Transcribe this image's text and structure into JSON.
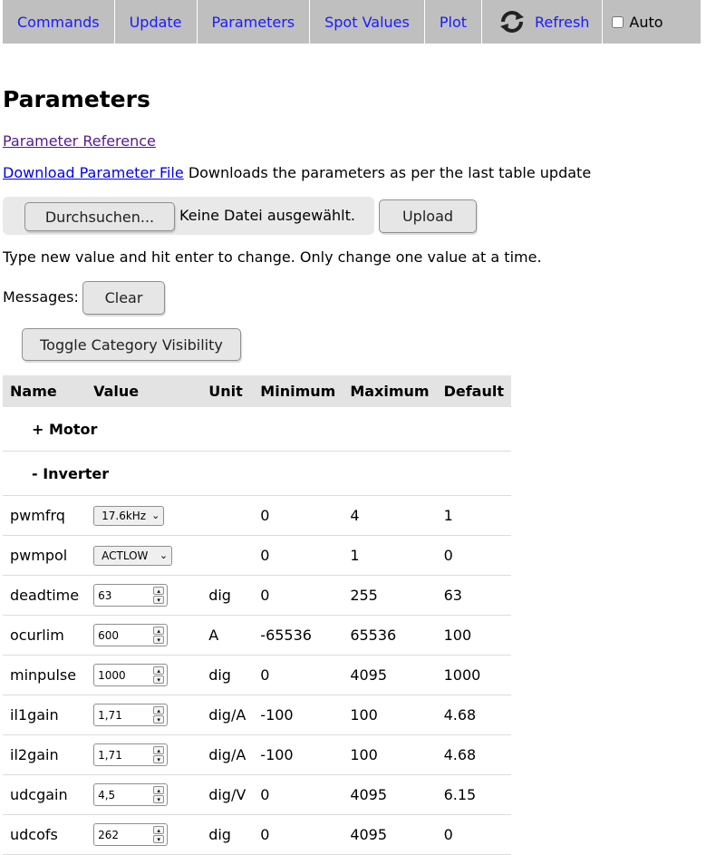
{
  "nav": {
    "items": [
      "Commands",
      "Update",
      "Parameters",
      "Spot Values",
      "Plot"
    ],
    "refresh_label": "Refresh",
    "auto_label": "Auto",
    "auto_checked": false
  },
  "page": {
    "title": "Parameters",
    "reference_link": "Parameter Reference",
    "download_link": "Download Parameter File",
    "download_note": "Downloads the parameters as per the last table update",
    "browse_label": "Durchsuchen...",
    "no_file_label": "Keine Datei ausgewählt.",
    "upload_label": "Upload",
    "hint": "Type new value and hit enter to change. Only change one value at a time.",
    "messages_label": "Messages:",
    "clear_label": "Clear",
    "toggle_label": "Toggle Category Visibility"
  },
  "table": {
    "headers": {
      "name": "Name",
      "value": "Value",
      "unit": "Unit",
      "min": "Minimum",
      "max": "Maximum",
      "default": "Default"
    },
    "categories": {
      "motor": "+ Motor",
      "inverter": "- Inverter"
    },
    "rows": [
      {
        "name": "pwmfrq",
        "value": "17.6kHz",
        "unit": "",
        "min": "0",
        "max": "4",
        "default": "1"
      },
      {
        "name": "pwmpol",
        "value": "ACTLOW",
        "unit": "",
        "min": "0",
        "max": "1",
        "default": "0"
      },
      {
        "name": "deadtime",
        "value": "63",
        "unit": "dig",
        "min": "0",
        "max": "255",
        "default": "63"
      },
      {
        "name": "ocurlim",
        "value": "600",
        "unit": "A",
        "min": "-65536",
        "max": "65536",
        "default": "100"
      },
      {
        "name": "minpulse",
        "value": "1000",
        "unit": "dig",
        "min": "0",
        "max": "4095",
        "default": "1000"
      },
      {
        "name": "il1gain",
        "value": "1,71",
        "unit": "dig/A",
        "min": "-100",
        "max": "100",
        "default": "4.68"
      },
      {
        "name": "il2gain",
        "value": "1,71",
        "unit": "dig/A",
        "min": "-100",
        "max": "100",
        "default": "4.68"
      },
      {
        "name": "udcgain",
        "value": "4,5",
        "unit": "dig/V",
        "min": "0",
        "max": "4095",
        "default": "6.15"
      },
      {
        "name": "udcofs",
        "value": "262",
        "unit": "dig",
        "min": "0",
        "max": "4095",
        "default": "0"
      }
    ]
  }
}
